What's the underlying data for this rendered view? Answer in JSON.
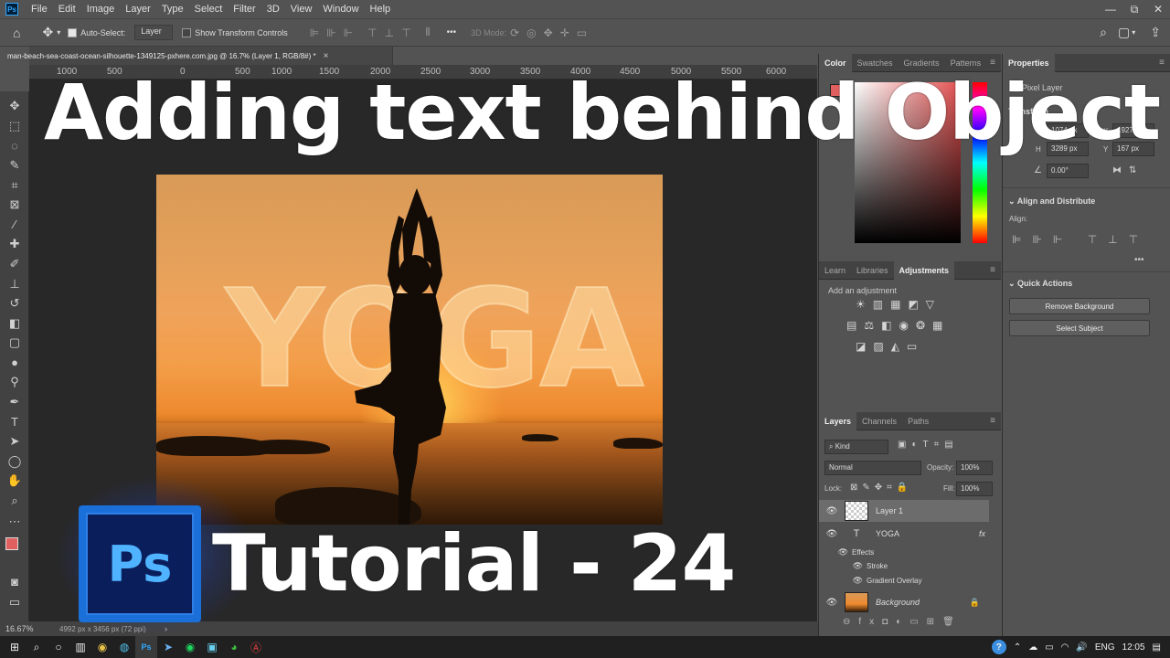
{
  "app": {
    "logo": "Ps"
  },
  "menu": [
    "File",
    "Edit",
    "Image",
    "Layer",
    "Type",
    "Select",
    "Filter",
    "3D",
    "View",
    "Window",
    "Help"
  ],
  "window_controls": [
    "—",
    "⧉",
    "✕"
  ],
  "options": {
    "auto_select_label": "Auto-Select:",
    "auto_select_value": "Layer",
    "transform_label": "Show Transform Controls",
    "more": "•••",
    "mode_3d": "3D Mode:"
  },
  "document": {
    "tab_title": "man-beach-sea-coast-ocean-silhouette-1349125-pxhere.com.jpg @ 16.7% (Layer 1, RGB/8#) *",
    "close": "×",
    "zoom": "16.67%",
    "info": "4992 px x 3456 px (72 ppi)",
    "status_arrow": "›"
  },
  "ruler": [
    "1000",
    "500",
    "0",
    "500",
    "1000",
    "1500",
    "2000",
    "2500",
    "3000",
    "3500",
    "4000",
    "4500",
    "5000",
    "5500",
    "6000"
  ],
  "canvas_text": "YOGA",
  "panels": {
    "color_tabs": [
      "Color",
      "Swatches",
      "Gradients",
      "Patterns"
    ],
    "properties_tab": "Properties",
    "pixel_layer": "Pixel Layer",
    "transform_label": "Transform",
    "w_label": "W",
    "w_value": "1074 px",
    "x_label": "X",
    "x_value": "1927 px",
    "h_label": "H",
    "h_value": "3289 px",
    "y_label": "Y",
    "y_value": "167 px",
    "angle": "0.00°",
    "align_head": "Align and Distribute",
    "align_label": "Align:",
    "quick_head": "Quick Actions",
    "remove_bg": "Remove Background",
    "select_subject": "Select Subject",
    "adj_tabs": [
      "Learn",
      "Libraries",
      "Adjustments"
    ],
    "add_adjustment": "Add an adjustment",
    "layers_tabs": [
      "Layers",
      "Channels",
      "Paths"
    ],
    "kind": "Kind",
    "blend": "Normal",
    "opacity_label": "Opacity:",
    "opacity_value": "100%",
    "lock_label": "Lock:",
    "fill_label": "Fill:",
    "fill_value": "100%",
    "layers": [
      {
        "name": "Layer 1"
      },
      {
        "name": "YOGA",
        "fx": "fx"
      },
      {
        "name": "Effects"
      },
      {
        "name": "Stroke"
      },
      {
        "name": "Gradient Overlay"
      },
      {
        "name": "Background"
      }
    ]
  },
  "overlay": {
    "title": "Adding text behind Object",
    "ps_badge": "Ps",
    "subtitle": "Tutorial - 24"
  },
  "taskbar": {
    "lang": "ENG",
    "time": "12:05",
    "help": "?"
  },
  "colors": {
    "accent": "#31a8ff",
    "fg_swatch": "#e06060",
    "panel": "#535353"
  }
}
